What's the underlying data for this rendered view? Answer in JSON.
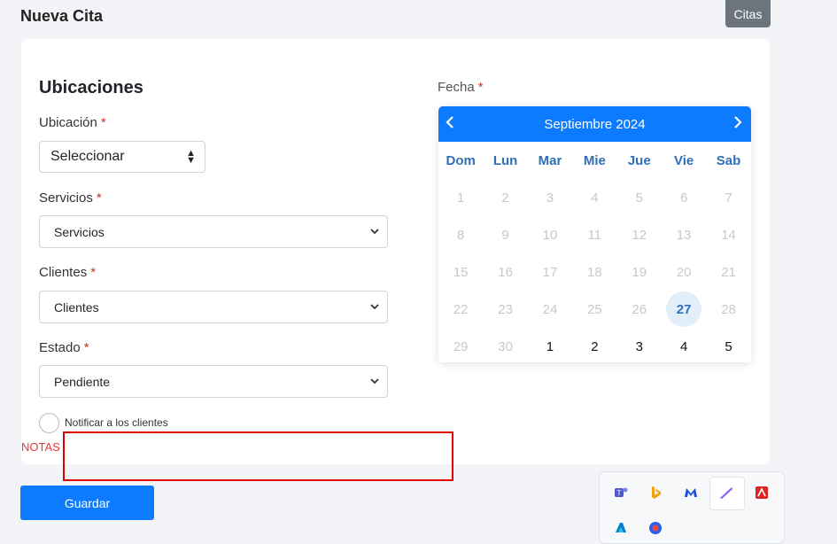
{
  "header": {
    "title": "Nueva Cita",
    "citas_button": "Citas"
  },
  "form": {
    "section_title": "Ubicaciones",
    "ubicacion": {
      "label": "Ubicación",
      "required": "*",
      "value": "Seleccionar"
    },
    "servicios": {
      "label": "Servicios",
      "required": "*",
      "value": "Servicios"
    },
    "clientes": {
      "label": "Clientes",
      "required": "*",
      "value": "Clientes"
    },
    "estado": {
      "label": "Estado",
      "required": "*",
      "value": "Pendiente"
    },
    "notify_label": "Notificar a los clientes",
    "notas_label": "NOTAS",
    "save_button": "Guardar"
  },
  "fecha": {
    "label": "Fecha",
    "required": "*",
    "calendar": {
      "month_title": "Septiembre 2024",
      "weekdays": [
        "Dom",
        "Lun",
        "Mar",
        "Mie",
        "Jue",
        "Vie",
        "Sab"
      ],
      "weeks": [
        [
          "1",
          "2",
          "3",
          "4",
          "5",
          "6",
          "7"
        ],
        [
          "8",
          "9",
          "10",
          "11",
          "12",
          "13",
          "14"
        ],
        [
          "15",
          "16",
          "17",
          "18",
          "19",
          "20",
          "21"
        ],
        [
          "22",
          "23",
          "24",
          "25",
          "26",
          "27",
          "28"
        ],
        [
          "29",
          "30",
          "1",
          "2",
          "3",
          "4",
          "5"
        ]
      ],
      "selected": "27",
      "accent": "#0d7bff"
    }
  },
  "tray": {
    "icons": [
      "teams-icon",
      "bing-icon",
      "malwarebytes-icon",
      "pen-icon",
      "adobe-icon",
      "azure-icon",
      "app-icon"
    ]
  }
}
